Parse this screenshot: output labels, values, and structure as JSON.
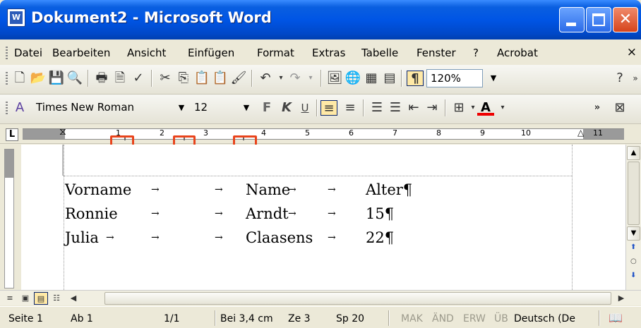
{
  "window": {
    "title": "Dokument2 - Microsoft Word",
    "app_icon_glyph": "W"
  },
  "menubar": {
    "items": [
      "Datei",
      "Bearbeiten",
      "Ansicht",
      "Einfügen",
      "Format",
      "Extras",
      "Tabelle",
      "Fenster",
      "?",
      "Acrobat"
    ],
    "close_glyph": "×"
  },
  "toolbar_standard": {
    "zoom": "120%",
    "pilcrow": "¶"
  },
  "toolbar_format": {
    "font": "Times New Roman",
    "size": "12",
    "bold": "F",
    "italic": "K",
    "underline": "U",
    "font_color_letter": "A"
  },
  "ruler": {
    "tab_selector": "L",
    "numbers": [
      "1",
      "2",
      "3",
      "4",
      "5",
      "6",
      "7",
      "8",
      "9",
      "10",
      "11"
    ]
  },
  "document": {
    "rows": [
      {
        "c1": "Vorname",
        "c2": "Name",
        "c3": "Alter¶"
      },
      {
        "c1": "Ronnie",
        "c2": "Arndt",
        "c3": "15¶"
      },
      {
        "c1": "Julia",
        "c2": "Claasens",
        "c3": "22¶"
      }
    ],
    "tab_arrow": "→"
  },
  "statusbar": {
    "page": "Seite 1",
    "section": "Ab 1",
    "pages": "1/1",
    "position": "Bei 3,4 cm",
    "line": "Ze 3",
    "column": "Sp 20",
    "mak": "MAK",
    "aend": "ÄND",
    "erw": "ERW",
    "ueb": "ÜB",
    "language": "Deutsch (De"
  },
  "colors": {
    "titlebar": "#0055E5",
    "highlight_box": "#E8441C",
    "toolbar_bg": "#ECE9D8"
  }
}
